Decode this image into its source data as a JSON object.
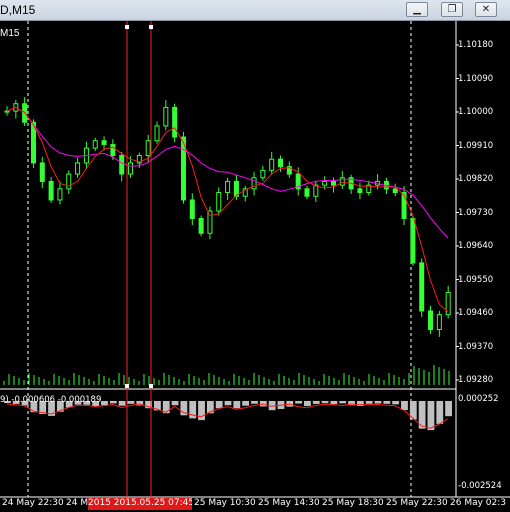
{
  "window": {
    "title": "D,M15",
    "minimize_icon": "minimize-icon",
    "restore_icon": "restore-icon",
    "close_icon": "close-icon"
  },
  "chart": {
    "symbol_label": "M15",
    "indicator_label": "9) -0.000606 -0.000189",
    "price_ticks": [
      "1.10180",
      "1.10090",
      "1.10000",
      "1.09910",
      "1.09820",
      "1.09730",
      "1.09640",
      "1.09550",
      "1.09460",
      "1.09370",
      "1.09280"
    ],
    "indicator_ticks": [
      "0.000252",
      "-0.002524"
    ],
    "time_ticks": [
      "24 May 22:30",
      "24 May",
      "25 May 10:30",
      "25 May 14:30",
      "25 May 18:30",
      "25 May 22:30",
      "26 May 02:3"
    ],
    "crosshair_time_label": "2015 2015.05.25 07:45",
    "colors": {
      "candle": "#33ff33",
      "ma_fast": "#ff1a1a",
      "ma_slow": "#ff00ff",
      "histogram": "#bfbfbf",
      "signal": "#ff1a1a",
      "vline": "#ff2020"
    }
  },
  "chart_data": {
    "type": "line",
    "title": "",
    "close": [
      1.0999,
      1.1001,
      1.0996,
      1.0985,
      1.098,
      1.0975,
      1.0978,
      1.0982,
      1.0985,
      1.0989,
      1.0991,
      1.099,
      1.0987,
      1.0982,
      1.0985,
      1.0987,
      1.0991,
      1.0995,
      1.1,
      1.0992,
      1.0975,
      1.097,
      1.0966,
      1.0972,
      1.0977,
      1.098,
      1.0976,
      1.0978,
      1.0981,
      1.0983,
      1.0986,
      1.0984,
      1.0982,
      1.0978,
      1.0976,
      1.0979,
      1.098,
      1.0979,
      1.0981,
      1.0978,
      1.0977,
      1.0979,
      1.098,
      1.0978,
      1.0977,
      1.097,
      1.0958,
      1.0945,
      1.094,
      1.0944,
      1.095
    ],
    "ylim": [
      1.0925,
      1.1022
    ]
  }
}
